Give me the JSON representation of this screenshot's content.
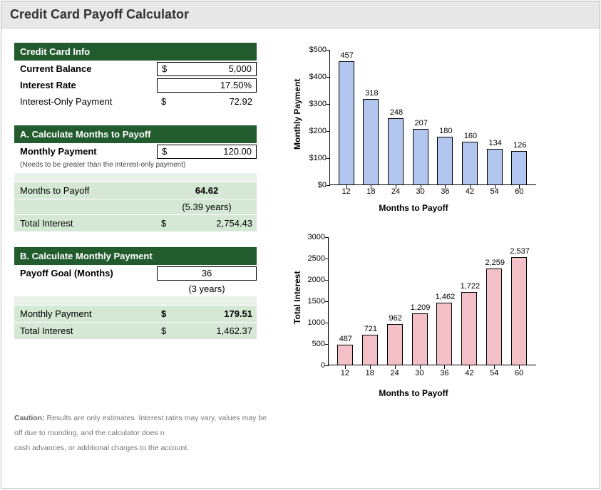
{
  "title": "Credit Card Payoff Calculator",
  "info": {
    "header": "Credit Card Info",
    "balance_label": "Current Balance",
    "balance_currency": "$",
    "balance_value": "5,000",
    "rate_label": "Interest Rate",
    "rate_value": "17.50%",
    "intonly_label": "Interest-Only Payment",
    "intonly_currency": "$",
    "intonly_value": "72.92"
  },
  "sectionA": {
    "header": "A. Calculate Months to Payoff",
    "payment_label": "Monthly Payment",
    "payment_currency": "$",
    "payment_value": "120.00",
    "hint": "(Needs to be greater than the interest-only payment)",
    "months_label": "Months to Payoff",
    "months_value": "64.62",
    "months_years": "(5.39 years)",
    "interest_label": "Total Interest",
    "interest_currency": "$",
    "interest_value": "2,754.43"
  },
  "sectionB": {
    "header": "B. Calculate Monthly Payment",
    "goal_label": "Payoff Goal (Months)",
    "goal_value": "36",
    "goal_years": "(3 years)",
    "payment_label": "Monthly Payment",
    "payment_currency": "$",
    "payment_value": "179.51",
    "interest_label": "Total Interest",
    "interest_currency": "$",
    "interest_value": "1,462.37"
  },
  "caution_strong": "Caution:",
  "caution1": " Results are only estimates. Interest rates may vary, values may be",
  "caution2": "off due to rounding, and the calculator does n",
  "caution3": "cash advances, or additional charges to the account.",
  "chart_data": [
    {
      "type": "bar",
      "categories": [
        12,
        18,
        24,
        30,
        36,
        42,
        54,
        60
      ],
      "values": [
        457,
        318,
        248,
        207,
        180,
        160,
        134,
        126
      ],
      "xlabel": "Months to Payoff",
      "ylabel": "Monthly Payment",
      "ylim": [
        0,
        500
      ],
      "ytick_step": 100,
      "yprefix": "$"
    },
    {
      "type": "bar",
      "categories": [
        12,
        18,
        24,
        30,
        36,
        42,
        54,
        60
      ],
      "values": [
        487,
        721,
        962,
        1209,
        1462,
        1722,
        2259,
        2537
      ],
      "xlabel": "Months to Payoff",
      "ylabel": "Total Interest",
      "ylim": [
        0,
        3000
      ],
      "ytick_step": 500,
      "yprefix": ""
    }
  ]
}
